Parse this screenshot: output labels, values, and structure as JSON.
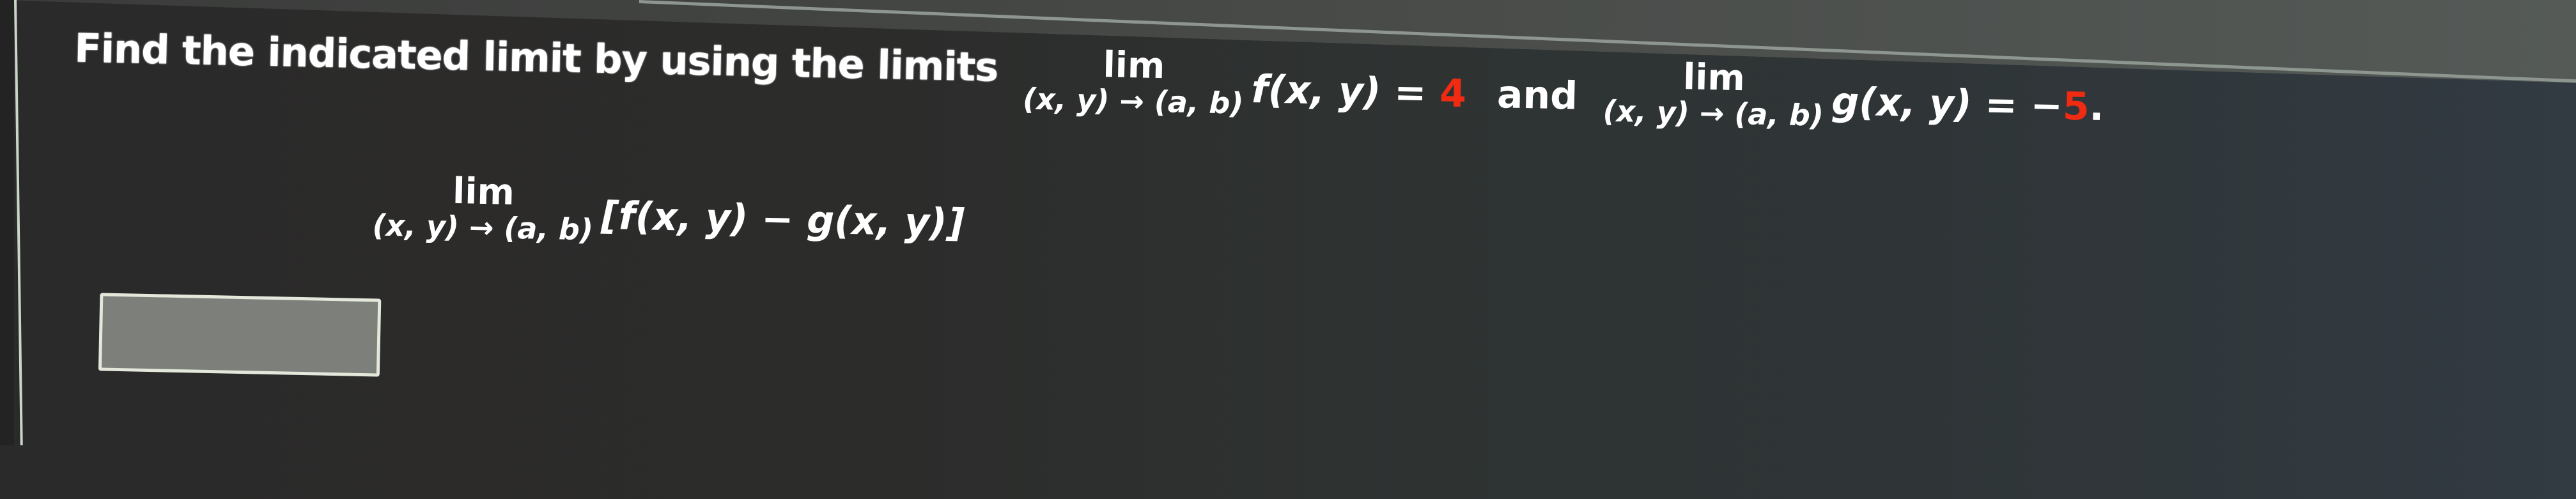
{
  "question": {
    "prompt": "Find the indicated limit by using the limits",
    "given1": {
      "lim": "lim",
      "sub_left": "(x, y)",
      "arrow": "→",
      "sub_right": "(a, b)",
      "function": "f(x, y) = ",
      "value": "4"
    },
    "connector": "and",
    "given2": {
      "lim": "lim",
      "sub_left": "(x, y)",
      "arrow": "→",
      "sub_right": "(a, b)",
      "function": "g(x, y) = −",
      "value": "5",
      "terminator": "."
    },
    "target": {
      "lim": "lim",
      "sub_left": "(x, y)",
      "arrow": "→",
      "sub_right": "(a, b)",
      "expression": "[f(x, y) − g(x, y)]"
    }
  },
  "answer": {
    "value": ""
  },
  "colors": {
    "highlight_value": "#f02b12",
    "text": "#ffffff",
    "background": "#2c2c2b",
    "answer_box_fill": "#7c7f7a",
    "answer_box_border": "#e3e8db"
  }
}
